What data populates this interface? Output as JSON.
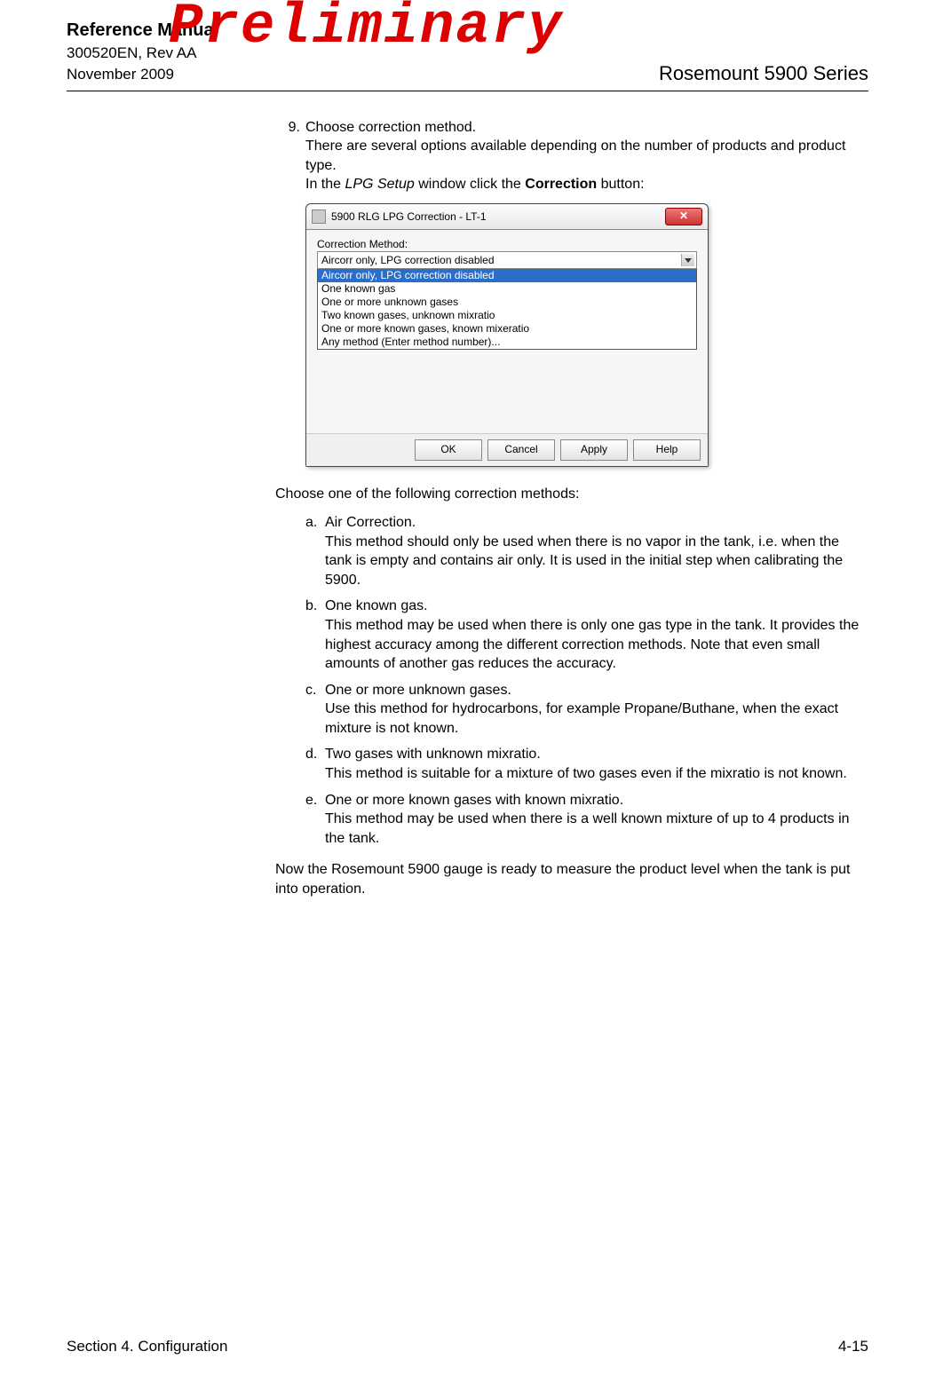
{
  "watermark": "Preliminary",
  "header": {
    "title": "Reference Manual",
    "docid": "300520EN, Rev AA",
    "date": "November 2009",
    "product": "Rosemount 5900 Series"
  },
  "step": {
    "number": "9.",
    "line1": "Choose correction method.",
    "line2": "There are several options available depending on the number of products and product type.",
    "line3_pre": "In the ",
    "line3_italic": "LPG Setup",
    "line3_mid": " window click the ",
    "line3_bold": "Correction",
    "line3_post": " button:"
  },
  "dialog": {
    "title": "5900 RLG LPG Correction - LT-1",
    "close": "✕",
    "label": "Correction Method:",
    "selected": "Aircorr only, LPG correction disabled",
    "options": [
      "Aircorr only, LPG correction disabled",
      "One known gas",
      "One or more unknown gases",
      "Two known gases, unknown mixratio",
      "One or more known gases, known mixeratio",
      "Any method (Enter method number)..."
    ],
    "buttons": {
      "ok": "OK",
      "cancel": "Cancel",
      "apply": "Apply",
      "help": "Help"
    }
  },
  "intro2": "Choose one of the following correction methods:",
  "subs": {
    "a": {
      "letter": "a.",
      "title": "Air Correction.",
      "text": "This method should only be used when there is no vapor in the tank, i.e. when the tank is empty and contains air only. It is used in the initial step when calibrating the 5900."
    },
    "b": {
      "letter": "b.",
      "title": "One known gas.",
      "text": "This method may be used when there is only one gas type in the tank. It provides the highest accuracy among the different correction methods. Note that even small amounts of another gas reduces the accuracy."
    },
    "c": {
      "letter": "c.",
      "title": "One or more unknown gases.",
      "text": "Use this method for hydrocarbons, for example Propane/Buthane, when the exact mixture is not known."
    },
    "d": {
      "letter": "d.",
      "title": "Two gases with unknown mixratio.",
      "text": "This method is suitable for a mixture of two gases even if the mixratio is not known."
    },
    "e": {
      "letter": "e.",
      "title": "One or more known gases with known mixratio.",
      "text": "This method may be used when there is a well known mixture of up to 4 products in the tank."
    }
  },
  "closing": "Now the Rosemount 5900 gauge is ready to measure the product level when the tank is put into operation.",
  "footer": {
    "section": "Section 4. Configuration",
    "page": "4-15"
  }
}
